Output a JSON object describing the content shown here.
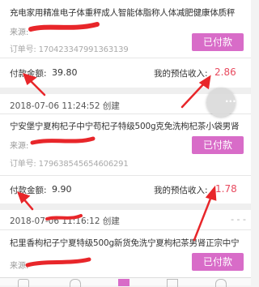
{
  "orders": [
    {
      "product": "充电家用精准电子体重秤成人智能体脂称人体减肥健康体质秤",
      "source_label": "来源:",
      "order_label": "订单号:",
      "order_number": "170423347991363139",
      "status_button": "已付款",
      "amount_label": "付款金额:",
      "amount": "39.80",
      "income_label": "我的预估收入:",
      "income": "2.86"
    },
    {
      "datetime": "2018-07-06 11:24:52",
      "created_label": "创建",
      "product": "宁安堡宁夏枸杞子中宁苟杞子特级500g克免洗枸杞茶小袋男肾",
      "source_label": "来源:",
      "order_label": "订单号:",
      "order_number": "179638545654606291",
      "status_button": "已付款",
      "amount_label": "付款金额:",
      "amount": "9.90",
      "income_label": "我的预估收入:",
      "income": "1.78"
    },
    {
      "datetime": "2018-07-06 11:16:12",
      "created_label": "创建",
      "product": "杞里香枸杞子宁夏特级500g新货免洗宁夏枸杞茶男肾正宗中宁",
      "source_label": "来源:",
      "status_button": "已付款"
    }
  ],
  "fab_icon": "more-dots-icon",
  "tabbar_icons": [
    "home-icon",
    "category-icon",
    "order-icon",
    "message-icon",
    "settings-icon"
  ],
  "colors": {
    "accent_button": "#d86cc8",
    "income": "#e84a5f",
    "annotation": "#e8262a"
  }
}
